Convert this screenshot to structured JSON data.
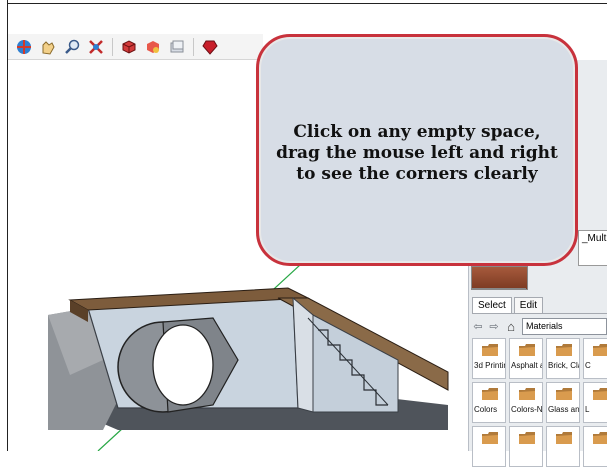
{
  "toolbar": {
    "icons": [
      "orbit-icon",
      "pan-icon",
      "zoom-icon",
      "zoom-extents-icon",
      "components-icon",
      "materials-icon",
      "scenes-icon",
      "ruby-icon"
    ]
  },
  "callout": {
    "text": "Click on any empty space, drag the mouse left and right to see the corners clearly"
  },
  "materials_panel": {
    "material_name_partial": "_Multi",
    "tabs": [
      "Select",
      "Edit"
    ],
    "collection": "Materials",
    "items": [
      {
        "label": "3d Printir"
      },
      {
        "label": "Asphalt a"
      },
      {
        "label": "Brick, Cla"
      },
      {
        "label": "C"
      },
      {
        "label": "Colors"
      },
      {
        "label": "Colors-N"
      },
      {
        "label": "Glass and"
      },
      {
        "label": "L"
      },
      {
        "label": ""
      },
      {
        "label": ""
      },
      {
        "label": ""
      },
      {
        "label": ""
      }
    ]
  },
  "colors": {
    "callout_border": "#c8323c",
    "callout_fill": "#d7dde6",
    "wall_blue": "#c8d3df",
    "roof_brown": "#7c5a3a",
    "floor_dark": "#4b5057",
    "axis_green": "#28a745"
  }
}
